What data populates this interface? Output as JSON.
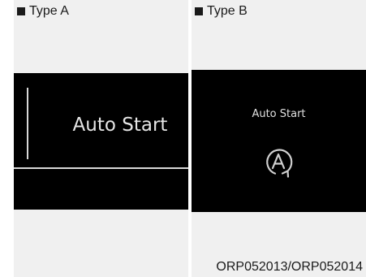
{
  "type_a": {
    "label": "Type A",
    "display_text": "Auto Start"
  },
  "type_b": {
    "label": "Type B",
    "display_text": "Auto Start",
    "icon": "auto-start-stop-icon"
  },
  "caption": "ORP052013/ORP052014",
  "colors": {
    "panel_background": "#f0f0f0",
    "screen_background": "#000000",
    "screen_text": "#e6e6e6"
  }
}
